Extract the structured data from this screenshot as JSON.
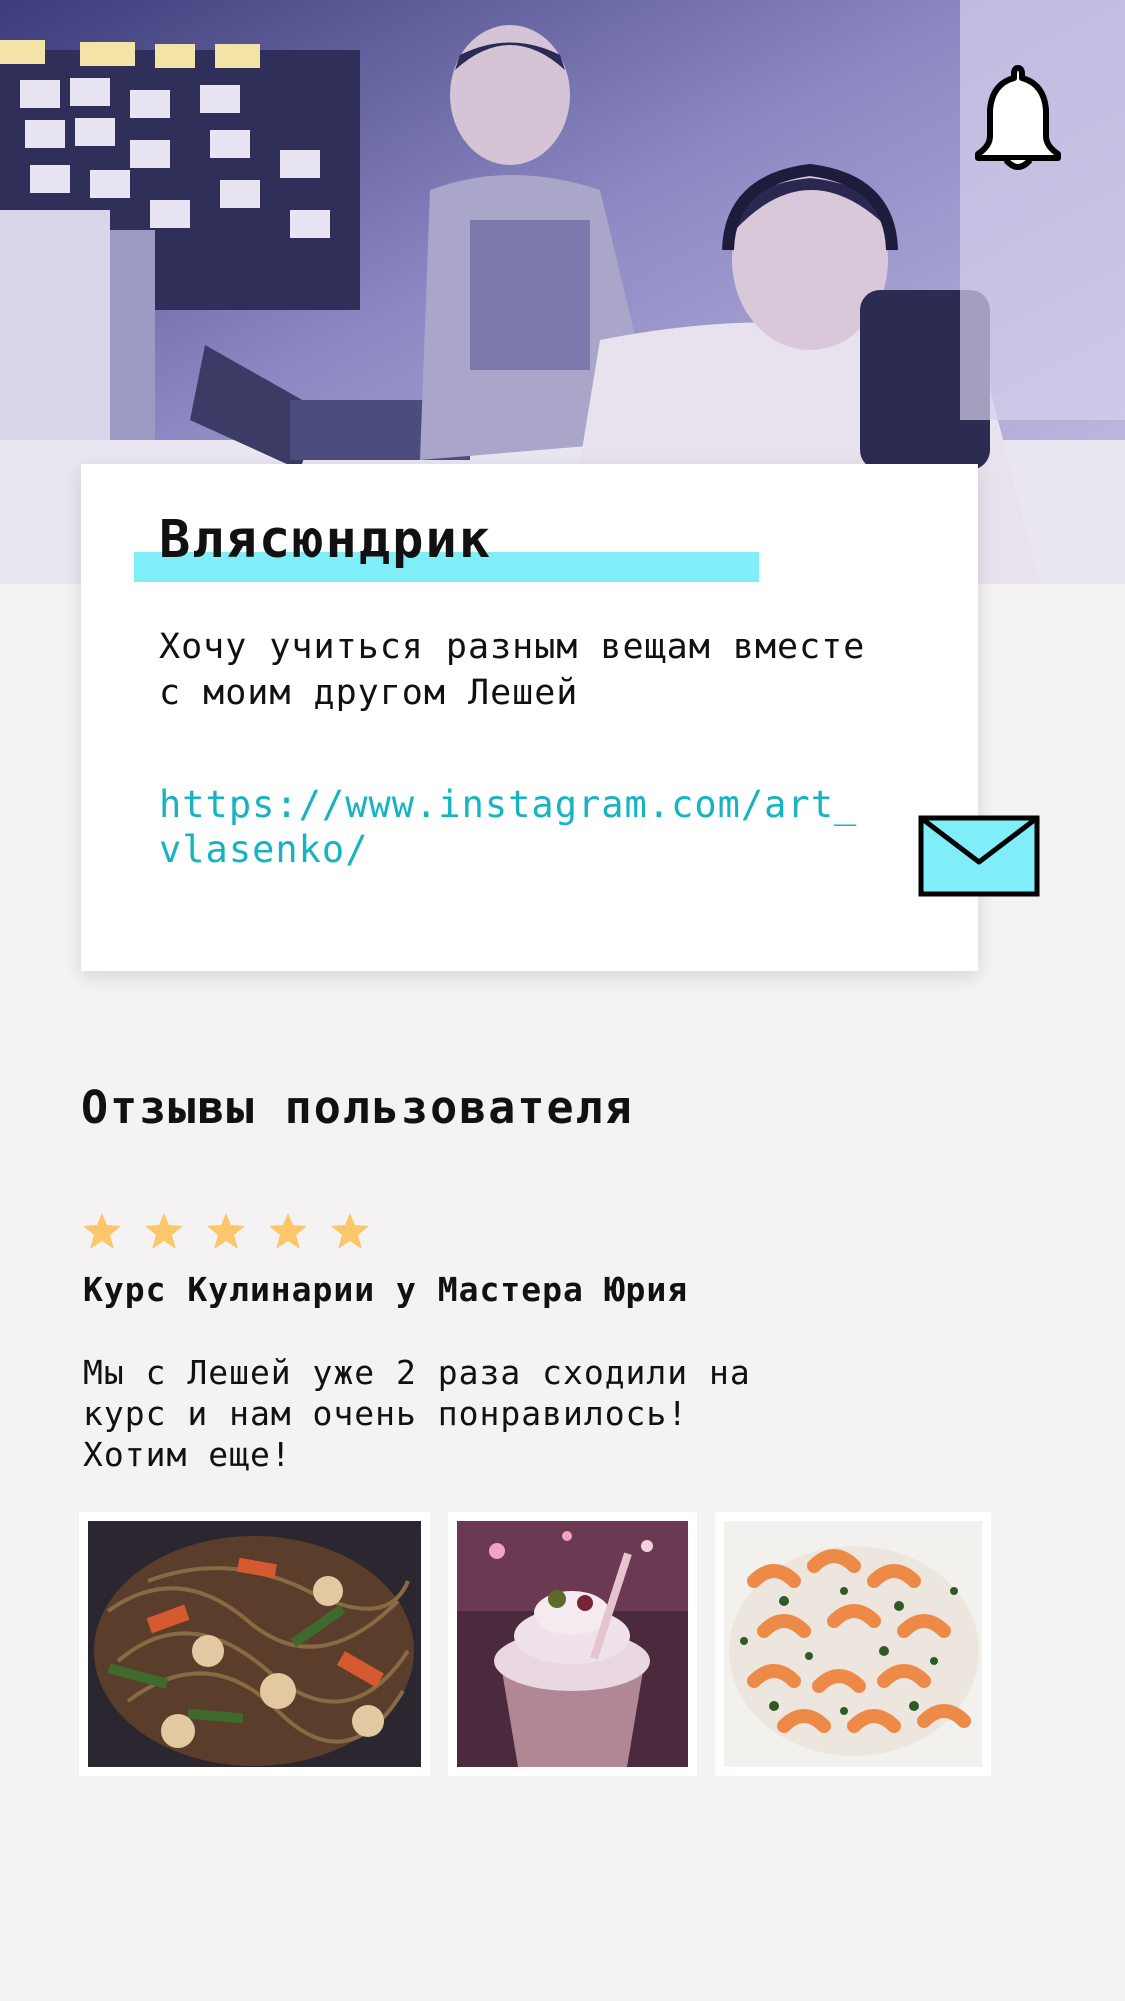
{
  "header": {
    "photo_name": "profile-cover-photo",
    "bell_icon": "bell-icon"
  },
  "profile": {
    "name": "Влясюндрик",
    "bio": "Хочу учиться разным вещам вместе с моим другом Лешей",
    "link": "https://www.instagram.com/art_vlasenko/",
    "message_icon": "envelope-icon"
  },
  "reviews": {
    "title": "Отзывы пользователя",
    "items": [
      {
        "rating": 5,
        "rating_max": 5,
        "course": "Курс Кулинарии у Мастера Юрия",
        "text": "Мы с Лешей уже 2 раза сходили на курс и нам очень понравилось! Хотим еще!",
        "photos": [
          "noodles-photo",
          "milkshake-photo",
          "shrimp-photo"
        ]
      }
    ]
  },
  "colors": {
    "highlight": "#80eef8",
    "link": "#16b4c3",
    "star": "#fcc76b",
    "background": "#f4f2f3",
    "envelope_fill": "#80eef8"
  }
}
